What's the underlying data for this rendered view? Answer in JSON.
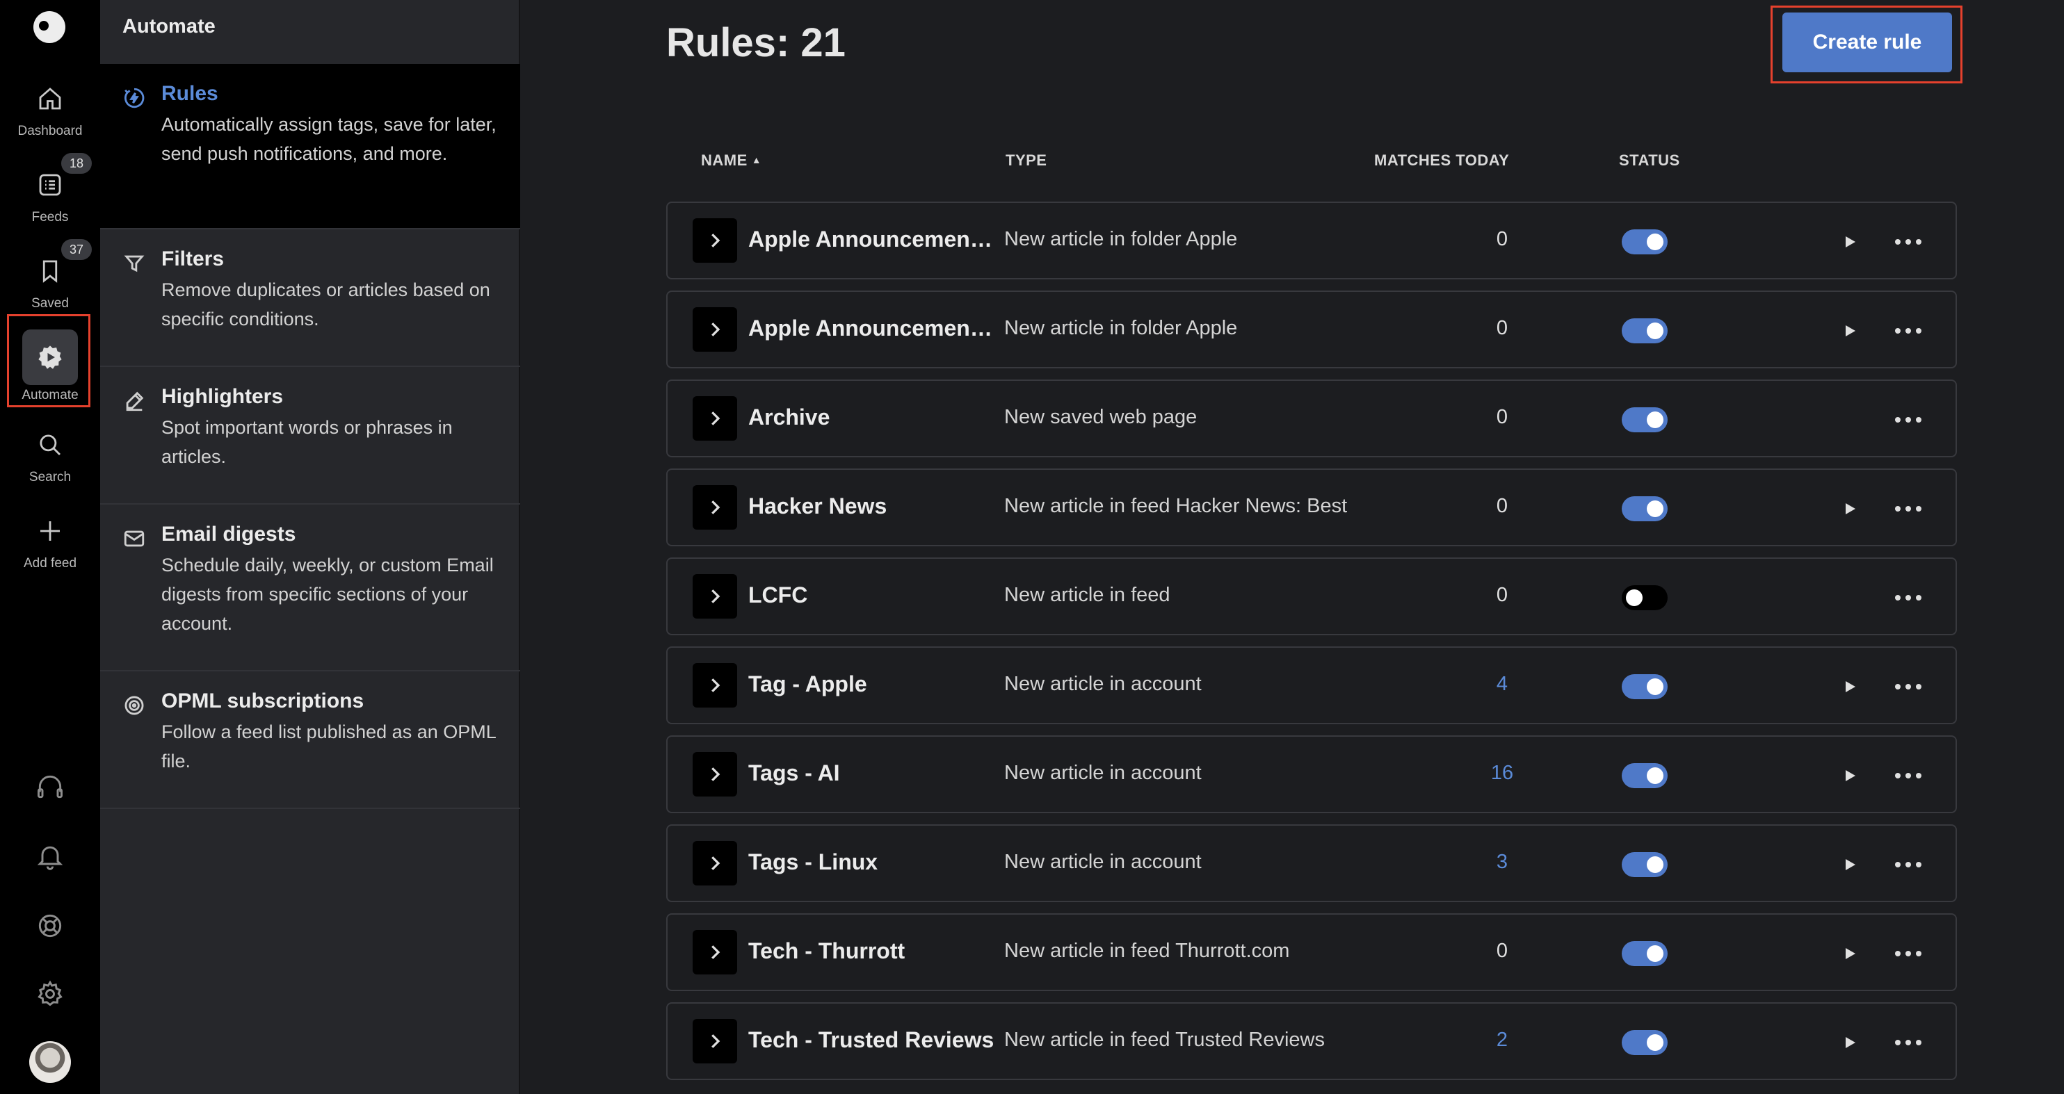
{
  "rail": {
    "items": [
      {
        "label": "Dashboard",
        "icon": "home-icon"
      },
      {
        "label": "Feeds",
        "icon": "feeds-icon",
        "badge": "18"
      },
      {
        "label": "Saved",
        "icon": "bookmark-icon",
        "badge": "37"
      },
      {
        "label": "Automate",
        "icon": "automate-icon",
        "active": true
      },
      {
        "label": "Search",
        "icon": "search-icon"
      },
      {
        "label": "Add feed",
        "icon": "plus-icon"
      }
    ],
    "bottom_icons": [
      "headphones-icon",
      "bell-icon",
      "help-icon",
      "gear-icon",
      "avatar"
    ]
  },
  "panel": {
    "title": "Automate",
    "items": [
      {
        "name": "Rules",
        "desc": "Automatically assign tags, save for later, send push notifications, and more.",
        "icon": "rules-icon",
        "active": true
      },
      {
        "name": "Filters",
        "desc": "Remove duplicates or articles based on specific conditions.",
        "icon": "filter-icon"
      },
      {
        "name": "Highlighters",
        "desc": "Spot important words or phrases in articles.",
        "icon": "highlighter-icon"
      },
      {
        "name": "Email digests",
        "desc": "Schedule daily, weekly, or custom Email digests from specific sections of your account.",
        "icon": "mail-icon"
      },
      {
        "name": "OPML subscriptions",
        "desc": "Follow a feed list published as an OPML file.",
        "icon": "opml-icon"
      }
    ]
  },
  "main": {
    "title": "Rules: 21",
    "create_button": "Create rule",
    "columns": {
      "name": "NAME",
      "type": "TYPE",
      "matches": "MATCHES TODAY",
      "status": "STATUS"
    },
    "rows": [
      {
        "name": "Apple Announcement…",
        "type": "New article in folder Apple",
        "matches": "0",
        "enabled": true,
        "play": true
      },
      {
        "name": "Apple Announcement…",
        "type": "New article in folder Apple",
        "matches": "0",
        "enabled": true,
        "play": true
      },
      {
        "name": "Archive",
        "type": "New saved web page",
        "matches": "0",
        "enabled": true,
        "play": false
      },
      {
        "name": "Hacker News",
        "type": "New article in feed Hacker News: Best",
        "matches": "0",
        "enabled": true,
        "play": true
      },
      {
        "name": "LCFC",
        "type": "New article in feed",
        "matches": "0",
        "enabled": false,
        "play": false
      },
      {
        "name": "Tag - Apple",
        "type": "New article in account",
        "matches": "4",
        "enabled": true,
        "play": true
      },
      {
        "name": "Tags - AI",
        "type": "New article in account",
        "matches": "16",
        "enabled": true,
        "play": true
      },
      {
        "name": "Tags - Linux",
        "type": "New article in account",
        "matches": "3",
        "enabled": true,
        "play": true
      },
      {
        "name": "Tech - Thurrott",
        "type": "New article in feed Thurrott.com",
        "matches": "0",
        "enabled": true,
        "play": true
      },
      {
        "name": "Tech - Trusted Reviews",
        "type": "New article in feed Trusted Reviews",
        "matches": "2",
        "enabled": true,
        "play": true
      }
    ]
  },
  "colors": {
    "accent": "#4f79c8",
    "link": "#5b8bd8",
    "highlight": "#e5412d"
  }
}
